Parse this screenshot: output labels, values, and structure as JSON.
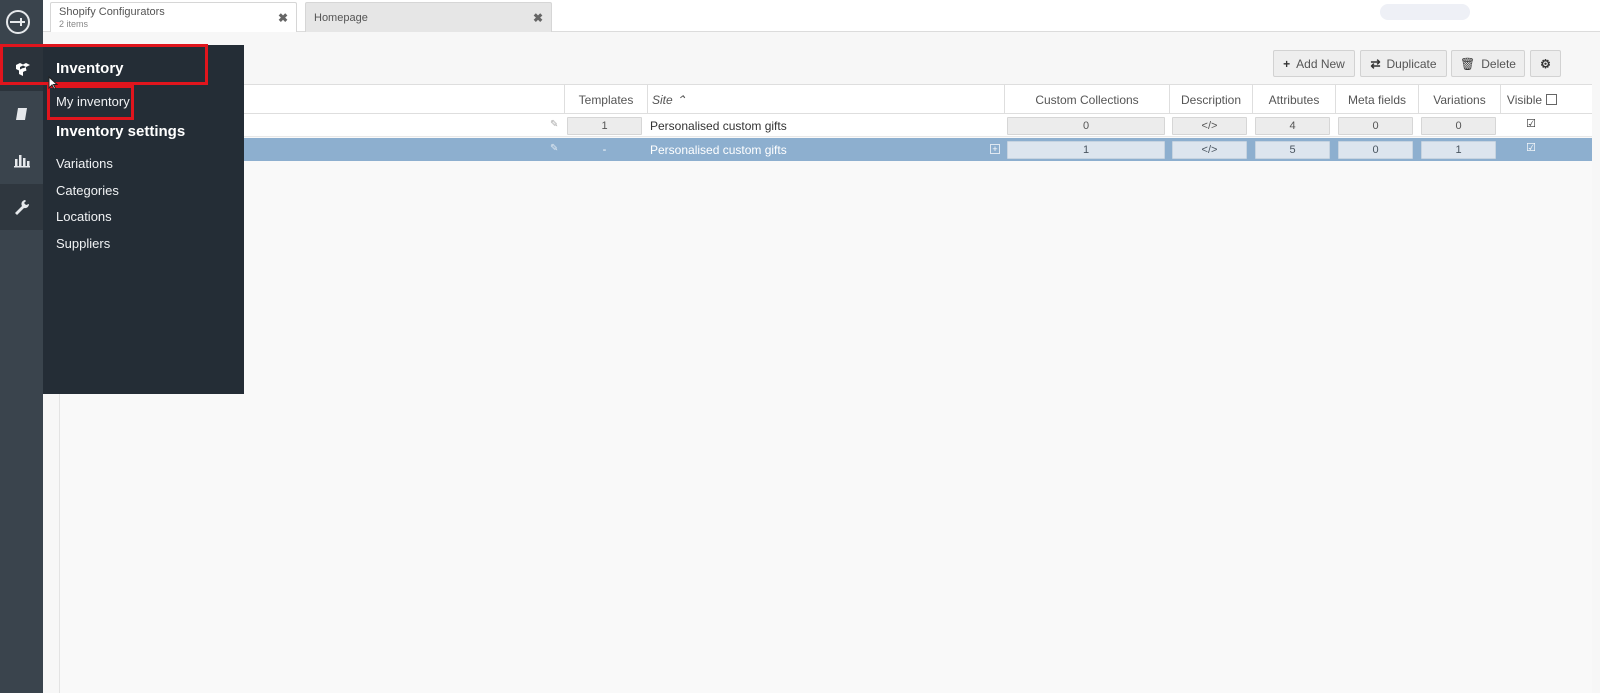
{
  "tabs": [
    {
      "title": "Shopify Configurators",
      "subtitle": "2 items",
      "close": "✖"
    },
    {
      "title": "Homepage",
      "close": "✖"
    }
  ],
  "toolbar": {
    "add_new": "Add New",
    "duplicate": "Duplicate",
    "delete": "Delete"
  },
  "menu": {
    "inventory": "Inventory",
    "my_inventory": "My inventory",
    "inventory_settings": "Inventory settings",
    "variations": "Variations",
    "categories": "Categories",
    "locations": "Locations",
    "suppliers": "Suppliers"
  },
  "table": {
    "headers": {
      "templates": "Templates",
      "site": "Site ⌃",
      "custom_collections": "Custom Collections",
      "description": "Description",
      "attributes": "Attributes",
      "meta_fields": "Meta fields",
      "variations": "Variations",
      "visible": "Visible"
    },
    "rows": [
      {
        "templates": "1",
        "site": "Personalised custom gifts",
        "custom_collections": "0",
        "description": "</>",
        "attributes": "4",
        "meta_fields": "0",
        "variations": "0",
        "visible": "☑",
        "selected": false
      },
      {
        "templates": "-",
        "site": "Personalised custom gifts",
        "custom_collections": "1",
        "description": "</>",
        "attributes": "5",
        "meta_fields": "0",
        "variations": "1",
        "visible": "☑",
        "selected": true
      }
    ]
  },
  "colors": {
    "rail": "#3a444d",
    "flyout": "#242d36",
    "selected_row": "#8dafcf",
    "highlight": "#e0151d"
  },
  "icons": {
    "rail": [
      "app-logo-icon",
      "inventory-icon",
      "book-icon",
      "chart-icon",
      "wrench-icon"
    ],
    "toolbar": [
      "plus-icon",
      "duplicate-icon",
      "trash-icon",
      "gear-icon"
    ]
  }
}
